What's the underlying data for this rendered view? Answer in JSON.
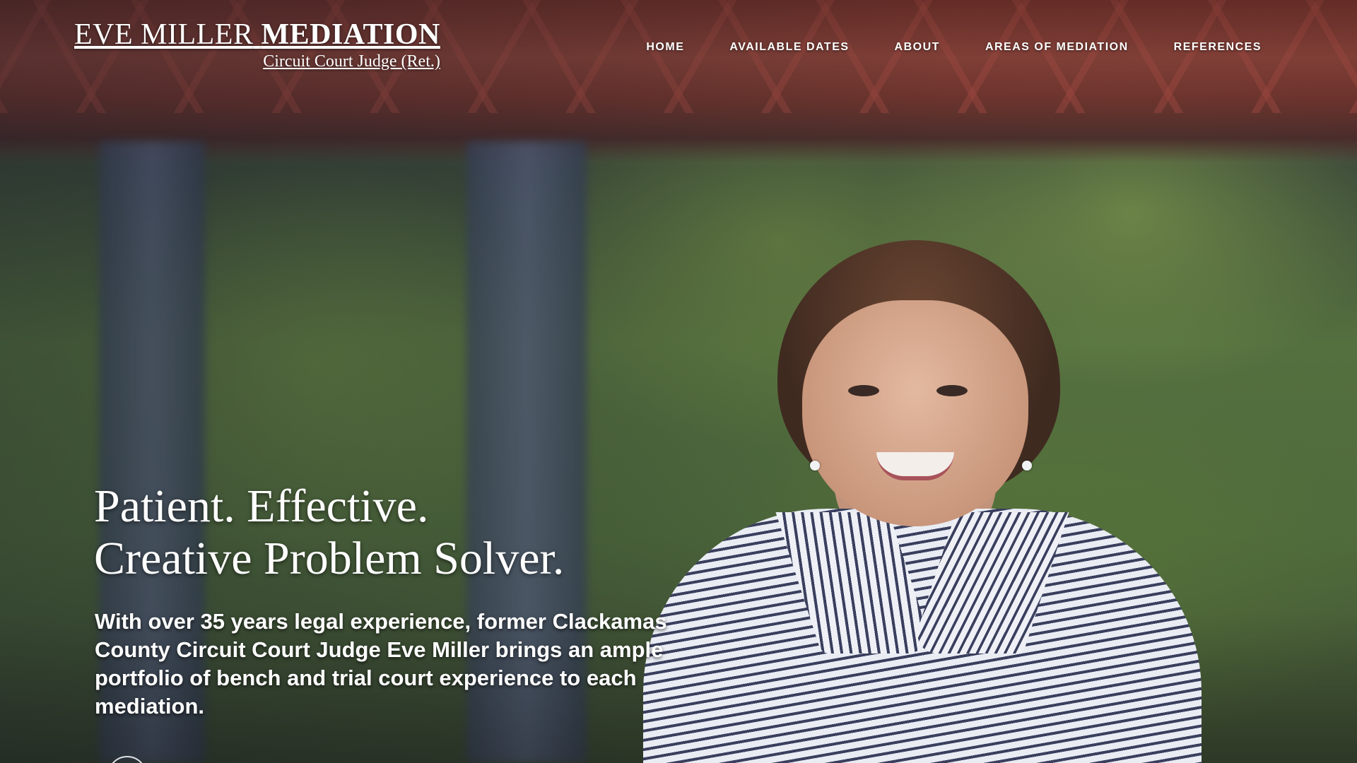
{
  "header": {
    "logo": {
      "name_light": "EVE MILLER",
      "name_bold": "MEDIATION",
      "subtitle": "Circuit Court Judge (Ret.)"
    },
    "nav": [
      {
        "label": "HOME"
      },
      {
        "label": "AVAILABLE DATES"
      },
      {
        "label": "ABOUT"
      },
      {
        "label": "AREAS OF MEDIATION"
      },
      {
        "label": "REFERENCES"
      }
    ]
  },
  "hero": {
    "headline_line1": "Patient. Effective.",
    "headline_line2": "Creative Problem Solver.",
    "lead": "With over 35 years legal experience, former Clackamas County Circuit Court Judge Eve Miller brings an ample portfolio of bench and trial court experience to each mediation."
  },
  "colors": {
    "text": "#ffffff",
    "bridge": "#8a3b34"
  },
  "icons": {
    "scroll": "scroll-down-circle-icon"
  }
}
